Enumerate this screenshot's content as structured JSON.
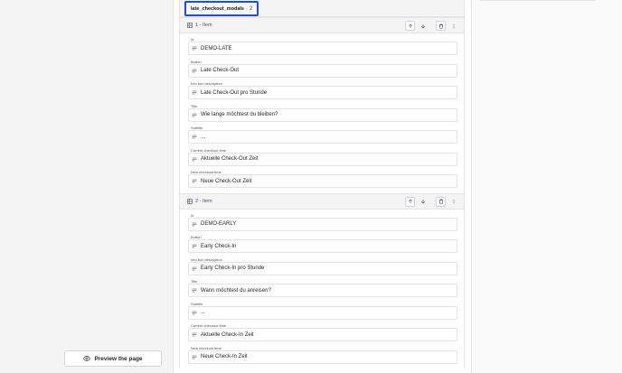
{
  "preview": {
    "label": "Preview the page"
  },
  "tab": {
    "name": "late_checkout_modals",
    "separator": "·",
    "count": "2"
  },
  "items": [
    {
      "title": "1 - Item",
      "fields": [
        {
          "label": "Id",
          "value": "DEMO-LATE"
        },
        {
          "label": "Button",
          "value": "Late Check-Out"
        },
        {
          "label": "Info box description",
          "value": "Late Check-Out pro Stunde"
        },
        {
          "label": "Title",
          "value": "Wie lange möchtest du bleiben?"
        },
        {
          "label": "Subtitle",
          "value": "..."
        },
        {
          "label": "Current checkout time",
          "value": "Aktuelle Check-Out Zeit"
        },
        {
          "label": "New checkout time",
          "value": "Neue Check-Out Zeit"
        }
      ]
    },
    {
      "title": "2 - Item",
      "fields": [
        {
          "label": "Id",
          "value": "DEMO-EARLY"
        },
        {
          "label": "Button",
          "value": "Early Check-In"
        },
        {
          "label": "Info box description",
          "value": "Early Check-In pro Stunde"
        },
        {
          "label": "Title",
          "value": "Wann möchtest du anreisen?"
        },
        {
          "label": "Subtitle",
          "value": "..."
        },
        {
          "label": "Current checkout time",
          "value": "Aktuelle Check-In Zeit"
        },
        {
          "label": "New checkout time",
          "value": "Neue Check-In Zeit"
        }
      ]
    }
  ],
  "icons": {
    "grid": "grid-icon",
    "text": "text-lines-icon",
    "up": "arrow-up-icon",
    "down": "arrow-down-icon",
    "trash": "trash-icon",
    "drag": "drag-handle-icon",
    "eye": "eye-icon"
  },
  "colors": {
    "accent": "#1d4ed8",
    "border": "#e4e4e7",
    "background": "#f4f4f5"
  }
}
